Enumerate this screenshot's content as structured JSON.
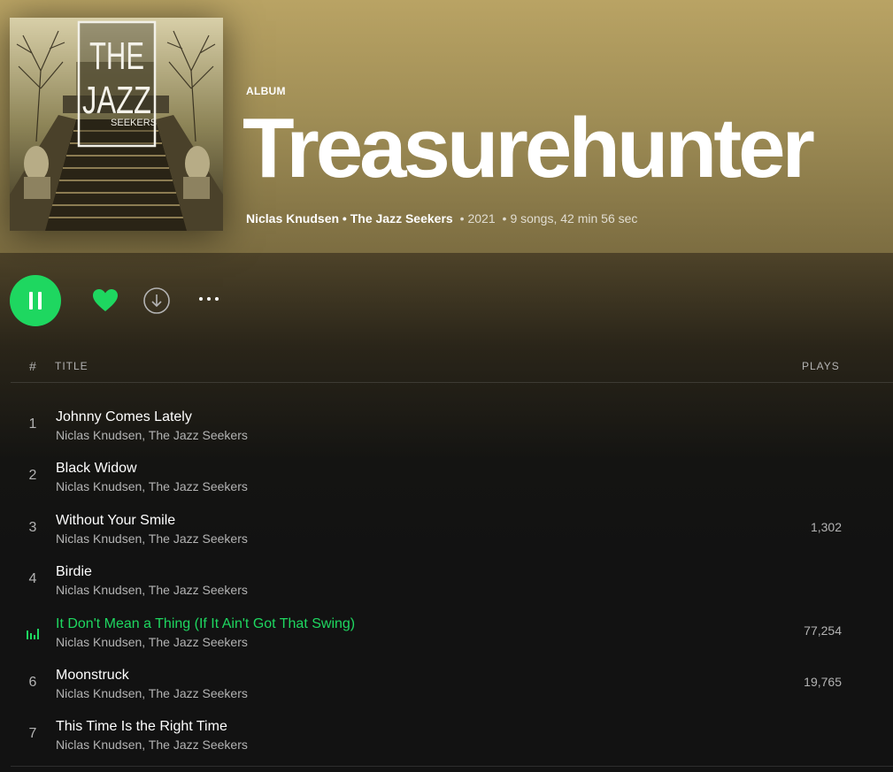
{
  "colors": {
    "accent": "#1ed760",
    "header": "#b9a364",
    "background": "#121212"
  },
  "cover": {
    "text_line1": "THE",
    "text_line2": "JAZZ",
    "text_line3": "SEEKERS"
  },
  "album": {
    "type": "ALBUM",
    "title": "Treasurehunter",
    "artist1": "Niclas Knudsen",
    "separator": "•",
    "artist2": "The Jazz Seekers",
    "year": "2021",
    "stats": "9 songs, 42 min 56 sec"
  },
  "actions": {
    "play_icon": "pause-icon",
    "like_icon": "heart-icon",
    "download_icon": "download-icon",
    "more_icon": "more-icon"
  },
  "table": {
    "col_number": "#",
    "col_title": "TITLE",
    "col_plays": "PLAYS",
    "tracks": [
      {
        "number": "1",
        "title": "Johnny Comes Lately",
        "artists": "Niclas Knudsen, The Jazz Seekers",
        "plays": ""
      },
      {
        "number": "2",
        "title": "Black Widow",
        "artists": "Niclas Knudsen, The Jazz Seekers",
        "plays": ""
      },
      {
        "number": "3",
        "title": "Without Your Smile",
        "artists": "Niclas Knudsen, The Jazz Seekers",
        "plays": "1,302"
      },
      {
        "number": "4",
        "title": "Birdie",
        "artists": "Niclas Knudsen, The Jazz Seekers",
        "plays": ""
      },
      {
        "number": "5",
        "title": "It Don't Mean a Thing (If It Ain't Got That Swing)",
        "artists": "Niclas Knudsen, The Jazz Seekers",
        "plays": "77,254",
        "playing": true
      },
      {
        "number": "6",
        "title": "Moonstruck",
        "artists": "Niclas Knudsen, The Jazz Seekers",
        "plays": "19,765"
      },
      {
        "number": "7",
        "title": "This Time Is the Right Time",
        "artists": "Niclas Knudsen, The Jazz Seekers",
        "plays": ""
      }
    ]
  }
}
